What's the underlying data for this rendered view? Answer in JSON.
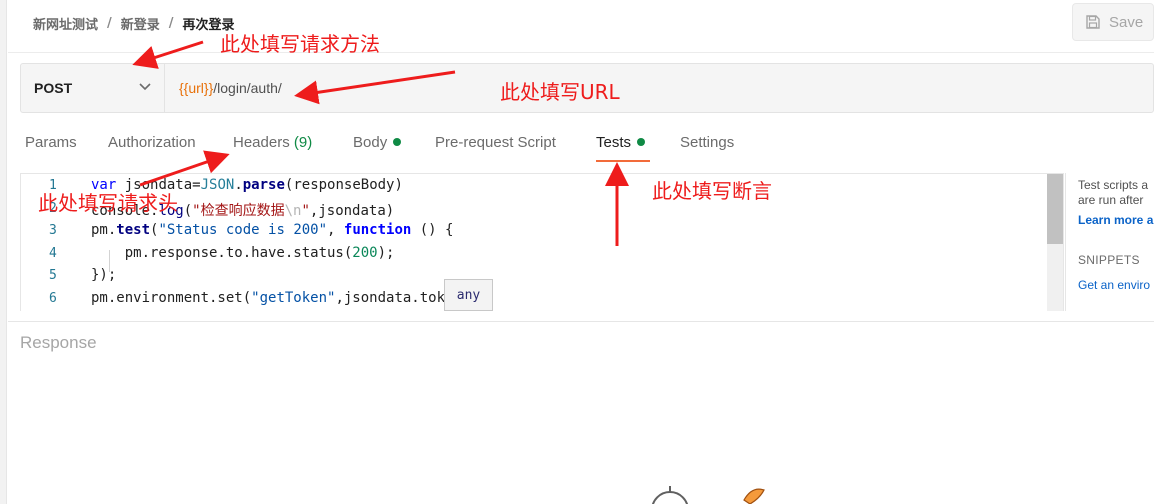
{
  "breadcrumb": [
    "新网址测试",
    "新登录",
    "再次登录"
  ],
  "breadcrumb_separator": "/",
  "save_label": "Save",
  "request": {
    "method": "POST",
    "url_variable": "{{url}}",
    "url_path": "/login/auth/"
  },
  "tabs": [
    {
      "label": "Params"
    },
    {
      "label": "Authorization"
    },
    {
      "label": "Headers",
      "count": "(9)"
    },
    {
      "label": "Body",
      "dot": true
    },
    {
      "label": "Pre-request Script"
    },
    {
      "label": "Tests",
      "dot": true,
      "active": true
    },
    {
      "label": "Settings"
    }
  ],
  "editor": {
    "line_numbers": [
      "1",
      "2",
      "3",
      "4",
      "5",
      "6"
    ],
    "tooltip": "any"
  },
  "side_panel": {
    "desc_line1": "Test scripts a",
    "desc_line2": "are run after",
    "learn_more": "Learn more a",
    "snippets_title": "SNIPPETS",
    "snippet_link": "Get an enviro"
  },
  "response_title": "Response",
  "annotations": {
    "method": "此处填写请求方法",
    "url": "此处填写URL",
    "headers": "此处填写请求头",
    "tests": "此处填写断言"
  },
  "colors": {
    "accent": "#f26b3a",
    "annotation": "#ee1c1c",
    "status_dot": "#0f8a45",
    "variable": "#e8710a"
  }
}
